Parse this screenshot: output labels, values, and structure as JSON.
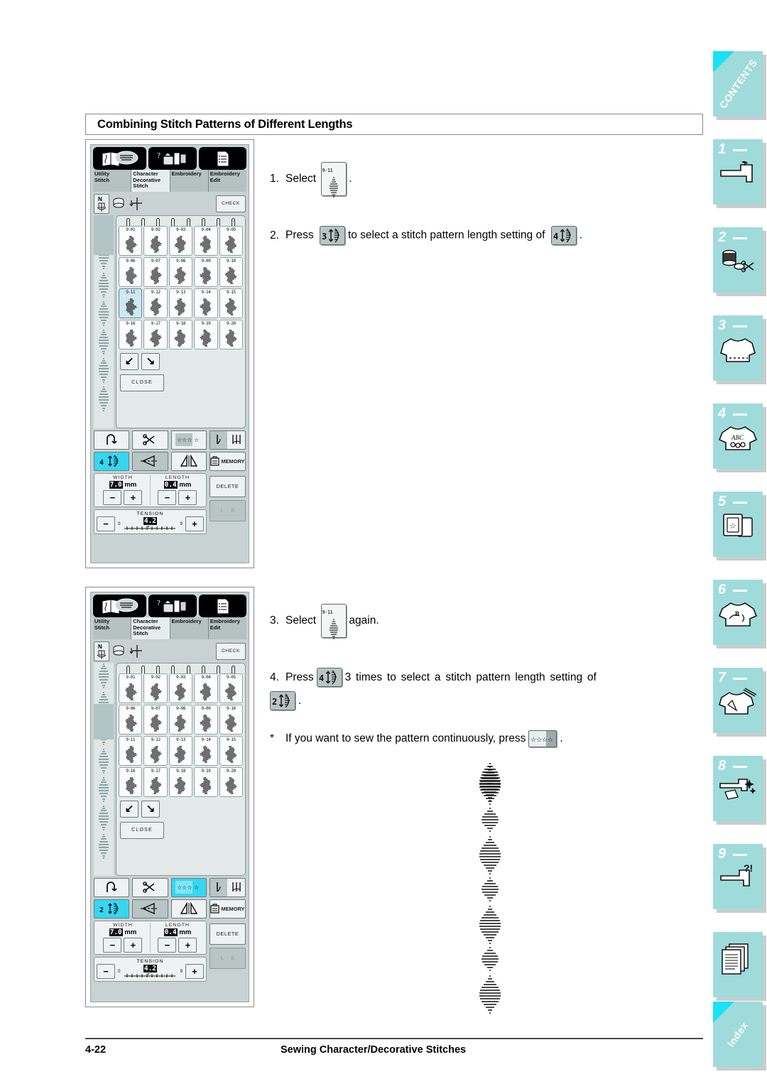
{
  "page": {
    "title": "Combining Stitch Patterns of Different Lengths",
    "footer_page_number": "4-22",
    "footer_title": "Sewing Character/Decorative Stitches"
  },
  "colors": {
    "sidebar_teal": "#9fdbdb",
    "sidebar_corner_cyan": "#18e2f5",
    "lcd_background": "#c8d2d2",
    "highlight_cyan": "#35d7f2",
    "selected_cell": "#cfe8f2"
  },
  "instructions": [
    {
      "number": "1.",
      "pre": "Select",
      "key": {
        "type": "stitch",
        "label": "9-11"
      },
      "post": "."
    },
    {
      "number": "2.",
      "pre": "Press",
      "key": {
        "type": "length",
        "value": "3"
      },
      "mid": "to select a stitch pattern length setting of",
      "key2": {
        "type": "length",
        "value": "4"
      },
      "post": "."
    },
    {
      "number": "3.",
      "pre": "Select",
      "key": {
        "type": "stitch",
        "label": "9-11"
      },
      "post": "again."
    },
    {
      "number": "4.",
      "pre": "Press",
      "key": {
        "type": "length",
        "value": "4"
      },
      "mid": "3 times to select a stitch pattern length setting of",
      "key2": {
        "type": "length",
        "value": "2"
      },
      "post": "."
    },
    {
      "number": "*",
      "pre": "If you want to sew the pattern continuously, press",
      "key": {
        "type": "star"
      },
      "post": "."
    }
  ],
  "machine_panels": [
    {
      "id": "panel-1",
      "tabs": [
        {
          "label": "Utility\nStitch",
          "active": false
        },
        {
          "label": "Character\nDecorative\nStitch",
          "active": true
        },
        {
          "label": "Embroidery",
          "active": false
        },
        {
          "label": "Embroidery\nEdit",
          "active": false
        }
      ],
      "check_button": "CHECK",
      "stitch_grid": [
        {
          "id": "9-01"
        },
        {
          "id": "9-02"
        },
        {
          "id": "9-03"
        },
        {
          "id": "9-04"
        },
        {
          "id": "9-05"
        },
        {
          "id": "9-06"
        },
        {
          "id": "9-07"
        },
        {
          "id": "9-08"
        },
        {
          "id": "9-09"
        },
        {
          "id": "9-10"
        },
        {
          "id": "9-11"
        },
        {
          "id": "9-12"
        },
        {
          "id": "9-13"
        },
        {
          "id": "9-14"
        },
        {
          "id": "9-15"
        },
        {
          "id": "9-16"
        },
        {
          "id": "9-17"
        },
        {
          "id": "9-18"
        },
        {
          "id": "9-19"
        },
        {
          "id": "9-20"
        }
      ],
      "selected_stitch": "9-11",
      "close_button": "CLOSE",
      "length_setting": "4",
      "length_highlighted": true,
      "star_highlighted": false,
      "width_label": "WIDTH",
      "width_value": "7.0",
      "width_unit": "mm",
      "length_label": "LENGTH",
      "length_value": "0.4",
      "length_unit": "mm",
      "tension_label": "TENSION",
      "tension_value": "4.2",
      "tension_min": "0",
      "tension_max": "9",
      "memory_button": "MEMORY",
      "delete_button": "DELETE",
      "ls_button_l": "L",
      "ls_button_s": "S",
      "minus": "−",
      "plus": "+"
    },
    {
      "id": "panel-2",
      "tabs": [
        {
          "label": "Utility\nStitch",
          "active": false
        },
        {
          "label": "Character\nDecorative\nStitch",
          "active": true
        },
        {
          "label": "Embroidery",
          "active": false
        },
        {
          "label": "Embroidery\nEdit",
          "active": false
        }
      ],
      "check_button": "CHECK",
      "stitch_grid": [
        {
          "id": "9-01"
        },
        {
          "id": "9-02"
        },
        {
          "id": "9-03"
        },
        {
          "id": "9-04"
        },
        {
          "id": "9-05"
        },
        {
          "id": "9-06"
        },
        {
          "id": "9-07"
        },
        {
          "id": "9-08"
        },
        {
          "id": "9-09"
        },
        {
          "id": "9-10"
        },
        {
          "id": "9-11"
        },
        {
          "id": "9-12"
        },
        {
          "id": "9-13"
        },
        {
          "id": "9-14"
        },
        {
          "id": "9-15"
        },
        {
          "id": "9-16"
        },
        {
          "id": "9-17"
        },
        {
          "id": "9-18"
        },
        {
          "id": "9-19"
        },
        {
          "id": "9-20"
        }
      ],
      "selected_stitch": "",
      "close_button": "CLOSE",
      "length_setting": "2",
      "length_highlighted": true,
      "star_highlighted": true,
      "width_label": "WIDTH",
      "width_value": "7.0",
      "width_unit": "mm",
      "length_label": "LENGTH",
      "length_value": "0.4",
      "length_unit": "mm",
      "tension_label": "TENSION",
      "tension_value": "4.2",
      "tension_min": "0",
      "tension_max": "9",
      "memory_button": "MEMORY",
      "delete_button": "DELETE",
      "ls_button_l": "L",
      "ls_button_s": "S",
      "minus": "−",
      "plus": "+"
    }
  ],
  "sidebar": {
    "contents_label": "CONTENTS",
    "index_label": "Index",
    "chapters": [
      {
        "number": "1",
        "icon": "sewing-machine-icon"
      },
      {
        "number": "2",
        "icon": "thread-spool-scissors-icon"
      },
      {
        "number": "3",
        "icon": "tshirt-stitch-icon"
      },
      {
        "number": "4",
        "icon": "tshirt-abc-icon"
      },
      {
        "number": "5",
        "icon": "embroidery-hoop-icon"
      },
      {
        "number": "6",
        "icon": "tshirt-letters-icon"
      },
      {
        "number": "7",
        "icon": "tshirt-tools-icon"
      },
      {
        "number": "8",
        "icon": "machine-clean-icon"
      },
      {
        "number": "9",
        "icon": "machine-question-icon"
      }
    ],
    "appendix_icon": "documents-icon"
  }
}
